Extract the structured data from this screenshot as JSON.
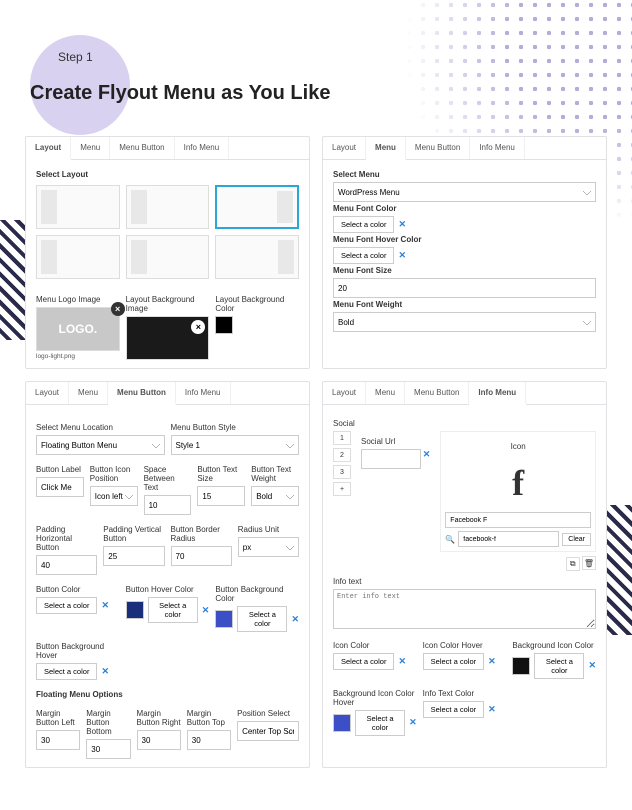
{
  "header": {
    "step": "Step 1",
    "title": "Create Flyout Menu as You Like"
  },
  "tabs": [
    "Layout",
    "Menu",
    "Menu Button",
    "Info Menu"
  ],
  "p1": {
    "active_tab": 0,
    "select_layout": "Select Layout",
    "ml_logo": "Menu Logo Image",
    "ml_bg": "Layout Background Image",
    "ml_bgcolor": "Layout Background Color",
    "logo_text": "LOGO.",
    "logo_caption": "logo-light.png"
  },
  "p2": {
    "active_tab": 1,
    "select_menu": "Select Menu",
    "menu_value": "WordPress Menu",
    "font_color": "Menu Font Color",
    "hover_color": "Menu Font Hover Color",
    "font_size": "Menu Font Size",
    "font_size_value": "20",
    "font_weight": "Menu Font Weight",
    "font_weight_value": "Bold",
    "select_color": "Select a color"
  },
  "p3": {
    "active_tab": 2,
    "sel_loc": "Select Menu Location",
    "sel_loc_value": "Floating Button Menu",
    "btn_style": "Menu Button Style",
    "btn_style_value": "Style 1",
    "btn_label": "Button Label",
    "btn_label_value": "Click Me",
    "icon_pos": "Button Icon Position",
    "icon_pos_value": "Icon left",
    "space": "Space Between Text",
    "space_value": "10",
    "text_size": "Button Text Size",
    "text_size_value": "15",
    "text_weight": "Button Text Weight",
    "text_weight_value": "Bold",
    "pad_h": "Padding Horizontal Button",
    "pad_h_value": "40",
    "pad_v": "Padding Vertical Button",
    "pad_v_value": "25",
    "radius": "Button Border Radius",
    "radius_value": "70",
    "radius_unit": "Radius Unit",
    "radius_unit_value": "px",
    "btn_color": "Button Color",
    "btn_hover": "Button Hover Color",
    "btn_bg": "Button Background Color",
    "btn_bg_hover": "Button Background Hover",
    "select_color": "Select a color",
    "float_opts": "Floating Menu Options",
    "m_left": "Margin Button Left",
    "m_left_v": "30",
    "m_bottom": "Margin Button Bottom",
    "m_bottom_v": "30",
    "m_right": "Margin Button Right",
    "m_right_v": "30",
    "m_top": "Margin Button Top",
    "m_top_v": "30",
    "pos_sel": "Position Select",
    "pos_sel_v": "Center Top Screen",
    "swatch_hover": "#1a2e7a",
    "swatch_bg": "#3b4fc7"
  },
  "p4": {
    "active_tab": 3,
    "social": "Social",
    "social_url": "Social Url",
    "icon": "Icon",
    "icon_name": "Facebook F",
    "search_value": "facebook-f",
    "clear": "Clear",
    "info_text": "Info text",
    "info_placeholder": "Enter info text",
    "icon_color": "Icon Color",
    "icon_hover": "Icon Color Hover",
    "bg_icon": "Background Icon Color",
    "bg_hover": "Background Icon Color Hover",
    "info_color": "Info Text Color",
    "select_color": "Select a color",
    "swatch_dark": "#111111",
    "swatch_blue": "#3b4fc7"
  }
}
